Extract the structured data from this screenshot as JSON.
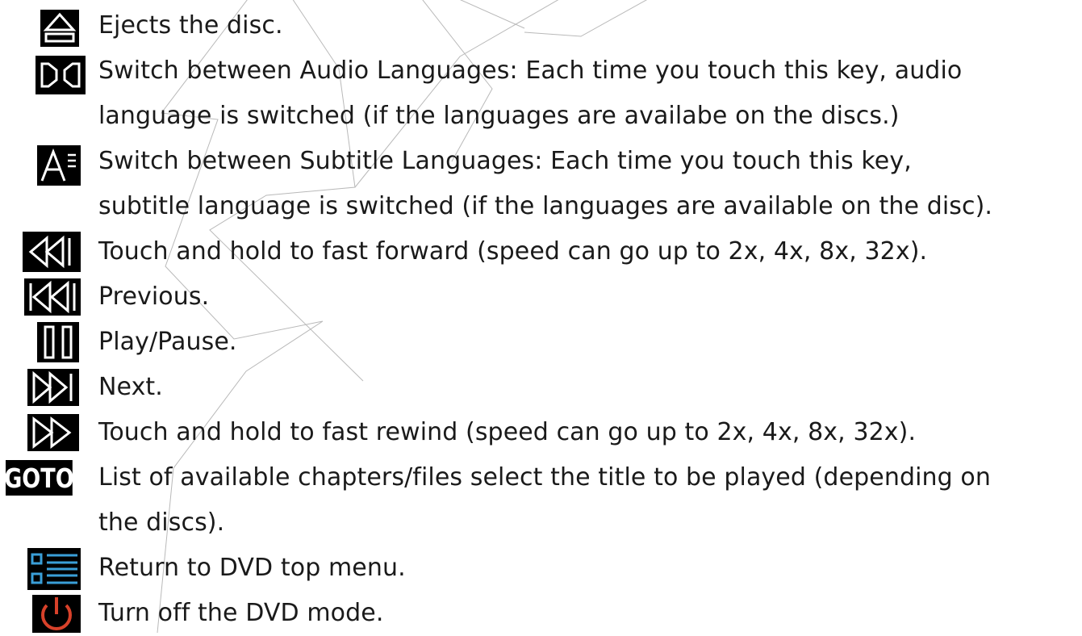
{
  "entries": [
    {
      "icon": "eject-icon",
      "lines": [
        "Ejects the disc."
      ]
    },
    {
      "icon": "audio-language-icon",
      "lines": [
        "Switch between Audio Languages: Each time you touch this key, audio",
        "language is switched (if the languages are availabe on the discs.)"
      ]
    },
    {
      "icon": "subtitle-language-icon",
      "lines": [
        "Switch between Subtitle Languages: Each time you touch this key,",
        "subtitle language is switched (if the languages are available on the disc)."
      ]
    },
    {
      "icon": "fast-forward-icon",
      "lines": [
        "Touch and hold to fast forward (speed can go up to 2x, 4x, 8x, 32x)."
      ]
    },
    {
      "icon": "previous-icon",
      "lines": [
        "Previous."
      ]
    },
    {
      "icon": "play-pause-icon",
      "lines": [
        "Play/Pause."
      ]
    },
    {
      "icon": "next-icon",
      "lines": [
        "Next."
      ]
    },
    {
      "icon": "fast-rewind-icon",
      "lines": [
        "Touch and hold to fast rewind (speed can go up to 2x, 4x, 8x, 32x)."
      ]
    },
    {
      "icon": "goto-icon",
      "icon_text": "GOTO",
      "lines": [
        "List of available chapters/files select the title to be played (depending on",
        "the discs)."
      ]
    },
    {
      "icon": "top-menu-icon",
      "lines": [
        "Return to DVD top menu."
      ]
    },
    {
      "icon": "power-icon",
      "lines": [
        "Turn off the DVD mode."
      ]
    }
  ],
  "colors": {
    "text": "#1a1a1a",
    "icon_background": "#000000",
    "menu_icon_accent": "#3a9fd8",
    "power_icon_accent": "#d8412a",
    "watermark_stroke": "#b0b0b0"
  }
}
